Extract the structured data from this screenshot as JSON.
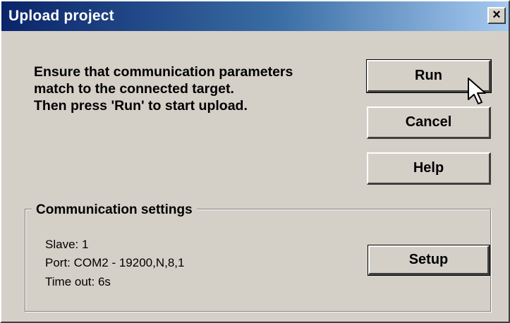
{
  "window": {
    "title": "Upload project",
    "close_label": "×"
  },
  "instructions": [
    "Ensure that communication parameters",
    "match to the connected target.",
    "Then press 'Run' to start upload."
  ],
  "buttons": {
    "run": "Run",
    "cancel": "Cancel",
    "help": "Help",
    "setup": "Setup"
  },
  "communication_settings": {
    "title": "Communication settings",
    "slave": "Slave: 1",
    "port": "Port: COM2 - 19200,N,8,1",
    "timeout": "Time out: 6s"
  }
}
